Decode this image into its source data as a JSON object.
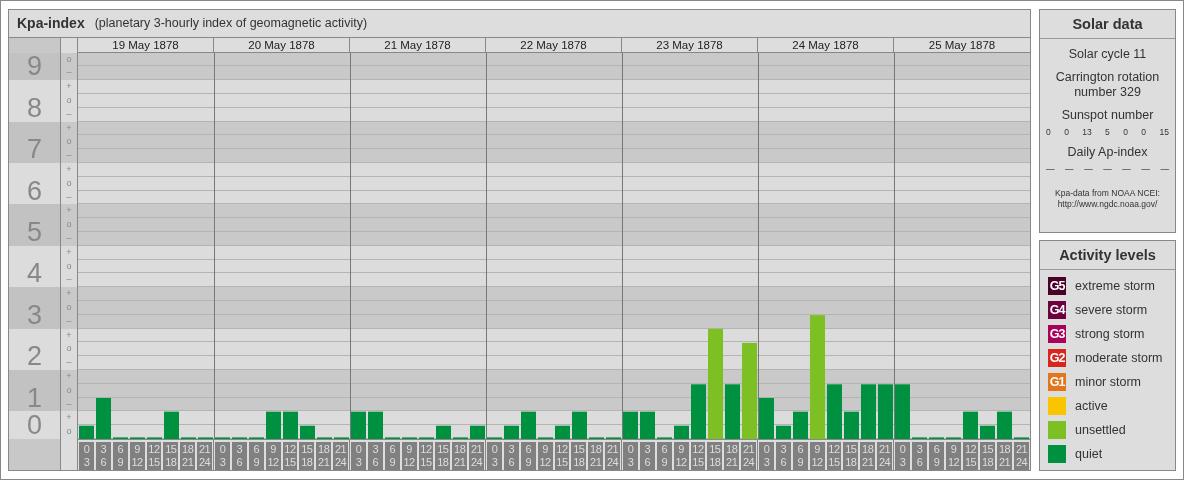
{
  "title": "Kpa-index",
  "subtitle": "(planetary 3-hourly index of geomagnetic activity)",
  "scale": [
    {
      "marks": [
        "o",
        "–"
      ]
    },
    {
      "marks": [
        "+",
        "o",
        "–"
      ]
    },
    {
      "marks": [
        "+",
        "o",
        "–"
      ]
    },
    {
      "marks": [
        "+",
        "o",
        "–"
      ]
    },
    {
      "marks": [
        "+",
        "o",
        "–"
      ]
    },
    {
      "marks": [
        "+",
        "o",
        "–"
      ]
    },
    {
      "marks": [
        "+",
        "o",
        "–"
      ]
    },
    {
      "marks": [
        "+",
        "o",
        "–"
      ]
    },
    {
      "marks": [
        "+",
        "o",
        "–"
      ]
    },
    {
      "label": "0",
      "marks": [
        "+",
        "o"
      ]
    }
  ],
  "days": [
    {
      "date": "19 May 1878"
    },
    {
      "date": "20 May 1878"
    },
    {
      "date": "21 May 1878"
    },
    {
      "date": "22 May 1878"
    },
    {
      "date": "23 May 1878"
    },
    {
      "date": "24 May 1878"
    },
    {
      "date": "25 May 1878"
    }
  ],
  "chart_data": {
    "type": "bar",
    "ylim": [
      0,
      9.33
    ],
    "grid": true,
    "yticks": [
      {
        "value": 1,
        "label": "1"
      },
      {
        "value": 2,
        "label": "2"
      },
      {
        "value": 3,
        "label": "3"
      },
      {
        "value": 4,
        "label": "4"
      },
      {
        "value": 5,
        "label": "5"
      },
      {
        "value": 6,
        "label": "6"
      },
      {
        "value": 7,
        "label": "7"
      },
      {
        "value": 8,
        "label": "8"
      },
      {
        "value": 9,
        "label": "9"
      }
    ],
    "categories": [
      "0 3",
      "3 6",
      "6 9",
      "9 12",
      "12 15",
      "15 18",
      "18 21",
      "21 24",
      "0 3",
      "3 6",
      "6 9",
      "9 12",
      "12 15",
      "15 18",
      "18 21",
      "21 24",
      "0 3",
      "3 6",
      "6 9",
      "9 12",
      "12 15",
      "15 18",
      "18 21",
      "21 24",
      "0 3",
      "3 6",
      "6 9",
      "9 12",
      "12 15",
      "15 18",
      "18 21",
      "21 24",
      "0 3",
      "3 6",
      "6 9",
      "9 12",
      "12 15",
      "15 18",
      "18 21",
      "21 24",
      "0 3",
      "3 6",
      "6 9",
      "9 12",
      "12 15",
      "15 18",
      "18 21",
      "21 24",
      "0 3",
      "3 6",
      "6 9",
      "9 12",
      "12 15",
      "15 18",
      "18 21",
      "21 24"
    ],
    "series": [
      {
        "color": "#009140",
        "values": [
          0.33,
          1,
          0,
          0,
          0,
          0.67,
          0,
          0,
          0,
          0,
          0,
          0.67,
          0.67,
          0.33,
          0,
          0,
          0.67,
          0.67,
          0,
          0,
          0,
          0.33,
          0,
          0.33,
          0,
          0.33,
          0.67,
          0,
          0.33,
          0.67,
          0,
          0,
          0.67,
          0.67,
          0,
          0.33,
          1.33,
          null,
          1.33,
          null,
          1,
          0.33,
          0.67,
          null,
          1.33,
          0.67,
          1.33,
          1.33,
          1.33,
          0,
          0,
          0,
          0.67,
          0.33,
          0.67,
          0
        ]
      },
      {
        "color": "#7cc023",
        "values": [
          null,
          null,
          null,
          null,
          null,
          null,
          null,
          null,
          null,
          null,
          null,
          null,
          null,
          null,
          null,
          null,
          null,
          null,
          null,
          null,
          null,
          null,
          null,
          null,
          null,
          null,
          null,
          null,
          null,
          null,
          null,
          null,
          null,
          null,
          null,
          null,
          null,
          2.67,
          null,
          2.33,
          null,
          null,
          null,
          3,
          null,
          null,
          null,
          null,
          null,
          null,
          null,
          null,
          null,
          null,
          null,
          null
        ]
      }
    ]
  },
  "solar": {
    "title": "Solar data",
    "cycle": "Solar cycle 11",
    "rotation": "Carrington rotation number 329",
    "sunspot_label": "Sunspot number",
    "sunspots": [
      "0",
      "0",
      "13",
      "5",
      "0",
      "0",
      "15"
    ],
    "ap_label": "Daily Ap-index",
    "ap": [
      "—",
      "—",
      "—",
      "—",
      "—",
      "—",
      "—"
    ],
    "source": "Kpa-data from NOAA NCEI: http://www.ngdc.noaa.gov/"
  },
  "activity": {
    "title": "Activity levels",
    "levels": [
      {
        "badge": "G5",
        "label": "extreme storm",
        "color": "#4a0027"
      },
      {
        "badge": "G4",
        "label": "severe storm",
        "color": "#6e0040"
      },
      {
        "badge": "G3",
        "label": "strong storm",
        "color": "#a9005a"
      },
      {
        "badge": "G2",
        "label": "moderate storm",
        "color": "#d8261c"
      },
      {
        "badge": "G1",
        "label": "minor storm",
        "color": "#e3761b"
      },
      {
        "label": "active",
        "color": "#f9c400"
      },
      {
        "label": "unsettled",
        "color": "#7cc023"
      },
      {
        "label": "quiet",
        "color": "#009140"
      }
    ]
  }
}
